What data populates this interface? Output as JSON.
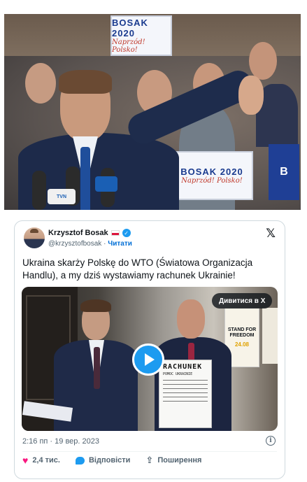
{
  "hero": {
    "sign_top": {
      "title": "BOSAK 2020",
      "subtitle": "Naprzód! Polsko!"
    },
    "sign_right": {
      "title": "BOSAK 2020",
      "subtitle": "Naprzód! Polsko!"
    },
    "sign_blue": "B",
    "mic_label": "TVN"
  },
  "tweet": {
    "author_name": "Krzysztof Bosak",
    "handle": "@krzysztofbosak",
    "separator": "·",
    "follow_label": "Читати",
    "x_logo": "𝕏",
    "text": "Ukraina skarży Polskę do WTO (Światowa Organizacja Handlu), a my dziś wystawiamy rachunek Ukrainie!",
    "media": {
      "watch_label": "Дивитися в X",
      "poster_text": "STAND FOR FREEDOM",
      "poster_date": "24.08",
      "bill_title": "RACHUNEK",
      "bill_subtitle": "POMOC UKRAINIE"
    },
    "timestamp": "2:16 пп · 19 вер. 2023",
    "likes": "2,4 тис.",
    "reply_label": "Відповісти",
    "share_label": "Поширення"
  },
  "colors": {
    "accent": "#1d9bf0",
    "like": "#f91880",
    "muted_text": "#536471"
  }
}
